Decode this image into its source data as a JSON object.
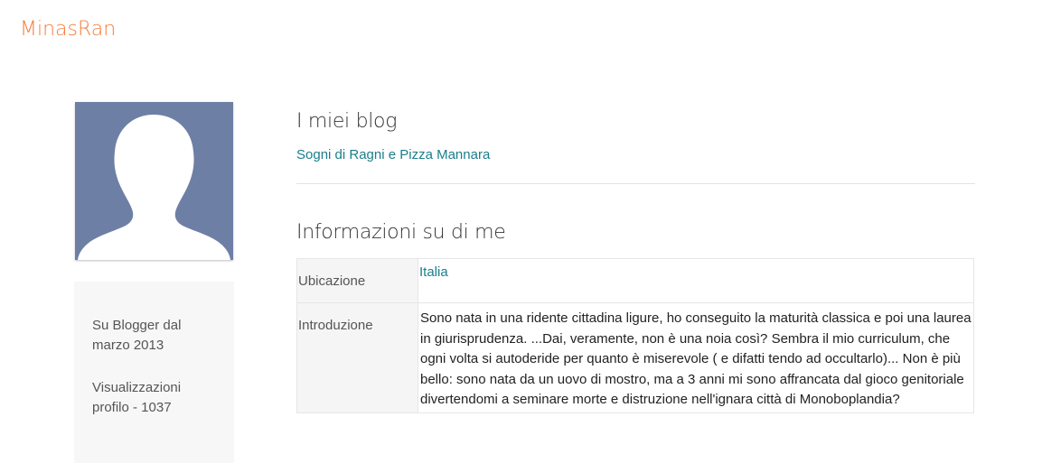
{
  "header": {
    "brand": "MinasRan",
    "brand_color": "#f57c3b"
  },
  "profile": {
    "avatar_icon": "default-user-silhouette-icon",
    "avatar_bg": "#6e7fa5",
    "member_since": "Su Blogger dal marzo 2013",
    "profile_views": "Visualizzazioni profilo - 1037"
  },
  "blogs": {
    "heading": "I miei blog",
    "items": [
      {
        "label": "Sogni di Ragni e Pizza Mannara"
      }
    ],
    "link_color": "#1a7e8a"
  },
  "about": {
    "heading": "Informazioni su di me",
    "rows": [
      {
        "label": "Ubicazione",
        "value": "Italia"
      },
      {
        "label": "Introduzione",
        "value": "Sono nata in una ridente cittadina ligure, ho conseguito la maturità classica e poi una laurea in giurisprudenza. ...Dai, veramente, non è una noia così? Sembra il mio curriculum, che ogni volta si autoderide per quanto è miserevole ( e difatti tendo ad occultarlo)... Non è più bello: sono nata da un uovo di mostro, ma a 3 anni mi sono affrancata dal gioco genitoriale divertendomi a seminare morte e distruzione nell'ignara città di Monoboplandia?"
      }
    ]
  }
}
